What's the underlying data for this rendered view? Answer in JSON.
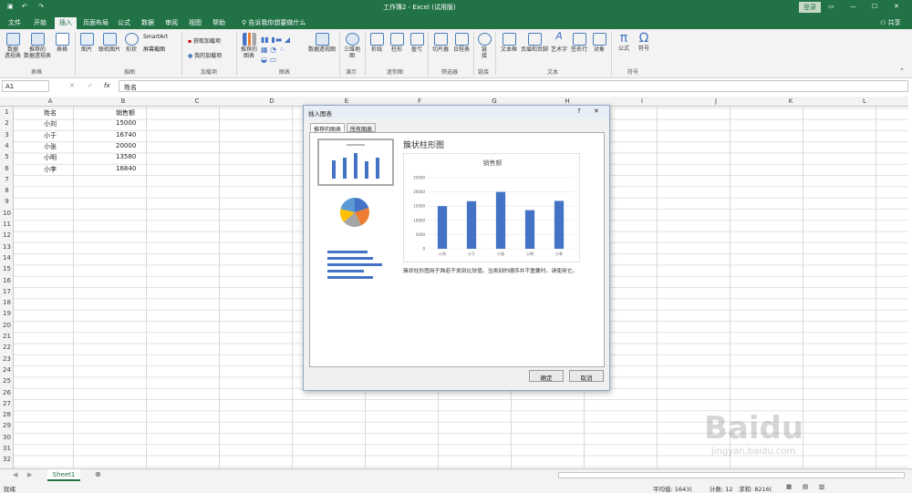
{
  "titlebar": {
    "title": "工作簿2 - Excel (试用版)",
    "login": "登录"
  },
  "tabs": [
    "文件",
    "开始",
    "插入",
    "页面布局",
    "公式",
    "数据",
    "审阅",
    "视图",
    "帮助"
  ],
  "tellme": "告诉我你想要做什么",
  "share": "共享",
  "ribbon": {
    "buttons": [
      {
        "label": "数据\n透视表",
        "icon": "pivot-table-icon"
      },
      {
        "label": "推荐的\n数据透视表",
        "icon": "recommended-pivot-icon"
      },
      {
        "label": "表格",
        "icon": "table-icon"
      },
      {
        "label": "图片",
        "icon": "picture-icon"
      },
      {
        "label": "联机图片",
        "icon": "online-picture-icon"
      },
      {
        "label": "形状",
        "icon": "shapes-icon"
      },
      {
        "label": "推荐的\n图表",
        "icon": "recommended-chart-icon"
      },
      {
        "label": "数据透视图",
        "icon": "pivot-chart-icon"
      },
      {
        "label": "三维地\n图",
        "icon": "map-3d-icon"
      },
      {
        "label": "折线",
        "icon": "line-sparkline-icon"
      },
      {
        "label": "柱形",
        "icon": "column-sparkline-icon"
      },
      {
        "label": "盈亏",
        "icon": "winloss-icon"
      },
      {
        "label": "切片器",
        "icon": "slicer-icon"
      },
      {
        "label": "日程表",
        "icon": "timeline-icon"
      },
      {
        "label": "链\n接",
        "icon": "link-icon"
      },
      {
        "label": "文本框",
        "icon": "textbox-icon"
      },
      {
        "label": "页眉和页脚",
        "icon": "header-footer-icon"
      },
      {
        "label": "艺术字",
        "icon": "wordart-icon"
      },
      {
        "label": "签名行",
        "icon": "signature-icon"
      },
      {
        "label": "对象",
        "icon": "object-icon"
      },
      {
        "label": "公式",
        "icon": "equation-icon"
      },
      {
        "label": "符号",
        "icon": "symbol-icon"
      }
    ],
    "smartart": "SmartArt",
    "screenshot": "屏幕截图",
    "getaddins": "获取加载项",
    "myaddins": "我的加载项",
    "groups": [
      "表格",
      "插图",
      "加载项",
      "图表",
      "演示",
      "迷你图",
      "筛选器",
      "链接",
      "文本",
      "符号"
    ]
  },
  "namebox": "A1",
  "formula": "姓名",
  "columns": [
    "A",
    "B",
    "C",
    "D",
    "E",
    "F",
    "G",
    "H",
    "I",
    "J",
    "K",
    "L"
  ],
  "rows": [
    "1",
    "2",
    "3",
    "4",
    "5",
    "6",
    "7",
    "8",
    "9",
    "10",
    "11",
    "12",
    "13",
    "14",
    "15",
    "16",
    "17",
    "18",
    "19",
    "20",
    "21",
    "22",
    "23",
    "24",
    "25",
    "26",
    "27",
    "28",
    "29",
    "30",
    "31",
    "32"
  ],
  "cells": {
    "header": [
      "姓名",
      "销售额"
    ],
    "data": [
      [
        "小刘",
        "15000"
      ],
      [
        "小于",
        "16740"
      ],
      [
        "小张",
        "20000"
      ],
      [
        "小明",
        "13580"
      ],
      [
        "小李",
        "16840"
      ]
    ]
  },
  "sheet": "Sheet1",
  "status": {
    "ready": "就绪",
    "average": "平均值: 1643(",
    "count": "计数: 12",
    "sum": "求和: 8216("
  },
  "dialog": {
    "title": "插入图表",
    "tab_recommended": "推荐的图表",
    "tab_all": "所有图表",
    "chart_name": "簇状柱形图",
    "description": "簇状柱形图用于跨若干类别比较值。当类别的顺序并不重要时，请使用它。",
    "ok": "确定",
    "cancel": "取消"
  },
  "chart_data": {
    "type": "bar",
    "title": "销售额",
    "categories": [
      "小刘",
      "小于",
      "小张",
      "小明",
      "小李"
    ],
    "values": [
      15000,
      16740,
      20000,
      13580,
      16840
    ],
    "ylim": [
      0,
      25000
    ],
    "yticks": [
      "0",
      "5000",
      "10000",
      "15000",
      "20000",
      "25000"
    ],
    "xlabel": "",
    "ylabel": "",
    "color": "#4472c4",
    "grid": true
  },
  "colors": {
    "excel_green": "#217346",
    "bar_blue": "#4472c4"
  }
}
